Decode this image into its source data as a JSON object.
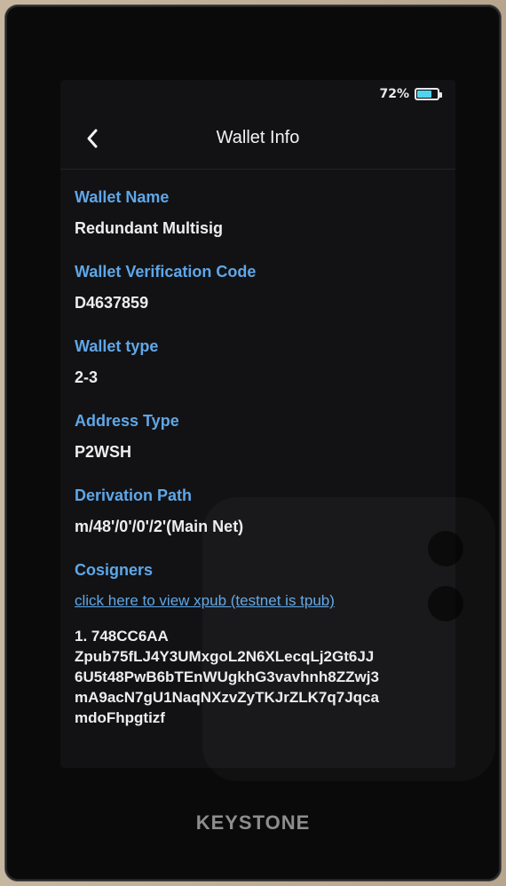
{
  "status": {
    "battery_percent_text": "72%",
    "battery_level": 0.72,
    "battery_color": "#4fd4ef"
  },
  "header": {
    "title": "Wallet Info",
    "back_icon": "chevron-left-icon"
  },
  "fields": {
    "wallet_name": {
      "label": "Wallet Name",
      "value": "Redundant Multisig"
    },
    "verification_code": {
      "label": "Wallet Verification Code",
      "value": "D4637859"
    },
    "wallet_type": {
      "label": "Wallet type",
      "value": "2-3"
    },
    "address_type": {
      "label": "Address Type",
      "value": "P2WSH"
    },
    "derivation_path": {
      "label": "Derivation Path",
      "value": "m/48'/0'/0'/2'(Main Net)"
    }
  },
  "cosigners": {
    "label": "Cosigners",
    "xpub_link": "click here to view xpub (testnet is tpub)",
    "items": [
      {
        "line1": "1. 748CC6AA",
        "line2": "Zpub75fLJ4Y3UMxgoL2N6XLecqLj2Gt6JJ",
        "line3": "6U5t48PwB6bTEnWUgkhG3vavhnh8ZZwj3",
        "line4": "mA9acN7gU1NaqNXzvZyTKJrZLK7q7Jqca",
        "line5": "mdoFhpgtizf"
      }
    ]
  },
  "device": {
    "brand": "KEYSTONE"
  },
  "colors": {
    "accent": "#5fa7e8",
    "text": "#ededed",
    "background": "#121214"
  }
}
